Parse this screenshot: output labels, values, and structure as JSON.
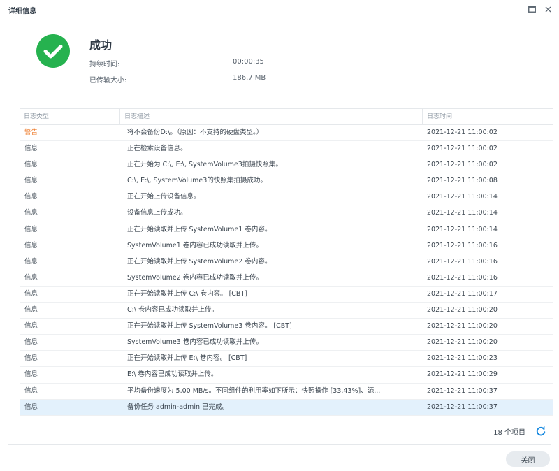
{
  "window": {
    "title": "详细信息",
    "maximize_icon": "maximize-icon",
    "close_icon": "close-icon"
  },
  "summary": {
    "status": "成功",
    "status_icon": "check-circle-icon",
    "status_color": "#26b24f",
    "duration_label": "持续时间:",
    "duration_value": "00:00:35",
    "size_label": "已传输大小:",
    "size_value": "186.7 MB"
  },
  "grid": {
    "columns": [
      "日志类型",
      "日志描述",
      "日志时间"
    ],
    "rows": [
      {
        "type": "警告",
        "desc": "将不会备份D:\\。（原因：不支持的硬盘类型。）",
        "time": "2021-12-21 11:00:02",
        "warn": true
      },
      {
        "type": "信息",
        "desc": "正在检索设备信息。",
        "time": "2021-12-21 11:00:02"
      },
      {
        "type": "信息",
        "desc": "正在开始为 C:\\, E:\\, SystemVolume3拍摄快照集。",
        "time": "2021-12-21 11:00:02"
      },
      {
        "type": "信息",
        "desc": "C:\\, E:\\, SystemVolume3的快照集拍摄成功。",
        "time": "2021-12-21 11:00:08"
      },
      {
        "type": "信息",
        "desc": "正在开始上传设备信息。",
        "time": "2021-12-21 11:00:14"
      },
      {
        "type": "信息",
        "desc": "设备信息上传成功。",
        "time": "2021-12-21 11:00:14"
      },
      {
        "type": "信息",
        "desc": "正在开始读取并上传 SystemVolume1 卷内容。",
        "time": "2021-12-21 11:00:14"
      },
      {
        "type": "信息",
        "desc": "SystemVolume1 卷内容已成功读取并上传。",
        "time": "2021-12-21 11:00:16"
      },
      {
        "type": "信息",
        "desc": "正在开始读取并上传 SystemVolume2 卷内容。",
        "time": "2021-12-21 11:00:16"
      },
      {
        "type": "信息",
        "desc": "SystemVolume2 卷内容已成功读取并上传。",
        "time": "2021-12-21 11:00:16"
      },
      {
        "type": "信息",
        "desc": "正在开始读取并上传 C:\\ 卷内容。 [CBT]",
        "time": "2021-12-21 11:00:17"
      },
      {
        "type": "信息",
        "desc": "C:\\ 卷内容已成功读取并上传。",
        "time": "2021-12-21 11:00:20"
      },
      {
        "type": "信息",
        "desc": "正在开始读取并上传 SystemVolume3 卷内容。 [CBT]",
        "time": "2021-12-21 11:00:20"
      },
      {
        "type": "信息",
        "desc": "SystemVolume3 卷内容已成功读取并上传。",
        "time": "2021-12-21 11:00:20"
      },
      {
        "type": "信息",
        "desc": "正在开始读取并上传 E:\\ 卷内容。 [CBT]",
        "time": "2021-12-21 11:00:23"
      },
      {
        "type": "信息",
        "desc": "E:\\ 卷内容已成功读取并上传。",
        "time": "2021-12-21 11:00:29"
      },
      {
        "type": "信息",
        "desc": "平均备份速度为 5.00 MB/s。不同组件的利用率如下所示：快照操作 [33.43%]、源...",
        "time": "2021-12-21 11:00:37"
      },
      {
        "type": "信息",
        "desc": "备份任务 admin-admin 已完成。",
        "time": "2021-12-21 11:00:37",
        "selected": true
      }
    ],
    "warn_color": "#ee7a29",
    "selected_color": "#e3f1fc"
  },
  "footer": {
    "count": "18 个项目",
    "refresh_icon": "refresh-icon",
    "close_label": "关闭"
  }
}
